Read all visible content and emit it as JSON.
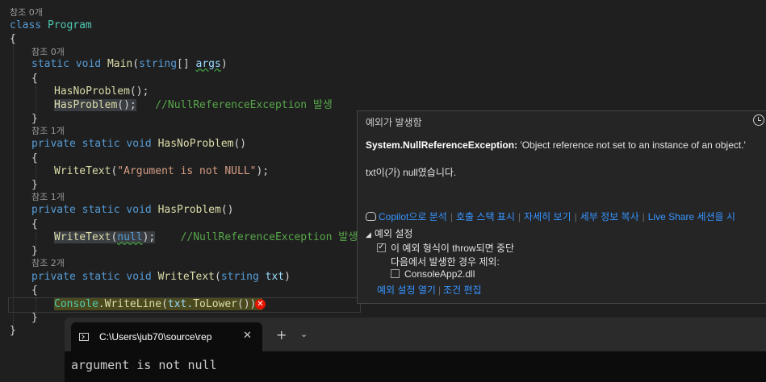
{
  "code": {
    "refs0": "참조 0개",
    "refs1": "참조 1개",
    "refs2": "참조 2개",
    "kw_class": "class",
    "class_name": "Program",
    "open_brace": "{",
    "close_brace": "}",
    "kw_static": "static",
    "kw_void": "void",
    "kw_private": "private",
    "kw_string": "string",
    "main_name": "Main",
    "main_params_open": "(",
    "main_params_close": "[] ",
    "args": "args",
    "paren_close": ")",
    "call_hasnoproblem": "HasNoProblem",
    "call_hasproblem": "HasProblem",
    "call_suffix": "();",
    "comment_nre": "//NullReferenceException 발생",
    "method_hasnoproblem": "HasNoProblem",
    "method_hasproblem": "HasProblem",
    "empty_parens": "()",
    "writetext": "WriteText",
    "arg_string": "\"Argument is not NULL\"",
    "call_end": ");",
    "kw_null": "null",
    "param_txt": "txt",
    "console": "Console",
    "writeline": "WriteLine",
    "txt_tolower": "txt.",
    "tolower": "ToLower",
    "tail": "());"
  },
  "exception_popup": {
    "title": "예외가 발생함",
    "exception_type": "System.NullReferenceException:",
    "exception_message": "'Object reference not set to an instance of an object.'",
    "detail": "txt이(가) null였습니다.",
    "links": [
      "Copilot으로 분석",
      "호출 스택 표시",
      "자세히 보기",
      "세부 정보 복사",
      "Live Share 세션을 시"
    ],
    "settings_header": "예외 설정",
    "break_when_thrown": "이 예외 형식이 throw되면 중단",
    "except_when_label": "다음에서 발생한 경우 제외:",
    "module": "ConsoleApp2.dll",
    "bottom_links": [
      "예외 설정 열기",
      "조건 편집"
    ],
    "break_checked": true,
    "module_checked": false
  },
  "terminal": {
    "tab_title": "C:\\Users\\jub70\\source\\rep",
    "close_glyph": "✕",
    "new_tab_glyph": "+",
    "dropdown_glyph": "⌄",
    "output": "argument is not null"
  },
  "icons": {
    "error": "error-icon",
    "history": "history-icon",
    "copilot": "copilot-icon",
    "terminal": "terminal-icon"
  }
}
